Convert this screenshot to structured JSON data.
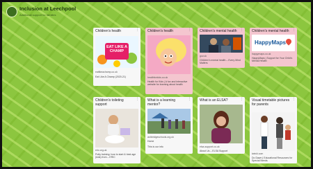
{
  "board": {
    "title": "Inclusion at Leechpool",
    "subtitle": "Additional support for families"
  },
  "cards": [
    {
      "title": "Children's health",
      "domain": "eatlikeachamp.co.uk",
      "desc": "Eat Like A Champ (2020-21)"
    },
    {
      "title": "Children's health",
      "domain": "healthforkids.co.uk",
      "desc": "Health for Kids | A fun and interactive website for learning about health"
    },
    {
      "title": "Children's mental health",
      "domain": "gov.uk",
      "desc": "Children's mental health – Every Mind Matters"
    },
    {
      "title": "Children's mental health",
      "domain": "happymaps.co.uk",
      "desc": "HappyMaps | Support for Your Child's Mental Health"
    },
    {
      "title": "Children's toileting support",
      "domain": "eric.org.uk",
      "desc": "Potty training: how to start & best age (kids) from – ERIC"
    },
    {
      "title": "What is a learning mentor?",
      "domain": "ashbridgeschools.org.uk",
      "desc": "Home\n\nThis is our info"
    },
    {
      "title": "What is an ELSA?",
      "domain": "elsa-support.co.uk",
      "desc": "About Us – ELSA Support"
    },
    {
      "title": "Visual timetable pictures for parents",
      "domain": "twinkl.com",
      "desc": "Do Dawn | Educational Resources for Special Needs"
    }
  ],
  "logo_text": {
    "champ": "EAT LIKE A CHAMP",
    "happymaps": "HappyMaps"
  }
}
